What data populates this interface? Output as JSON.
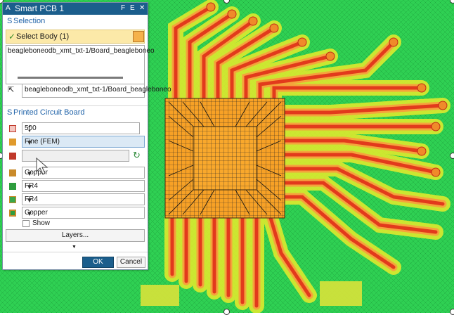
{
  "dialog": {
    "app_letter": "A",
    "title": "Smart PCB 1",
    "title_buttons": [
      "F",
      "E"
    ],
    "close_glyph": "✕"
  },
  "selection": {
    "section_marker": "S",
    "section_title": "Selection",
    "select_body_label": "Select Body (1)",
    "list_item": "beagleboneodb_xmt_txt-1/Board_beagleboneo",
    "body_field": "beagleboneodb_xmt_txt-1/Board_beagleboneo"
  },
  "pcb": {
    "section_marker": "S",
    "section_title": "Printed Circuit Board",
    "size_value": "500",
    "fidelity_value": "Fine (FEM)",
    "param_value": "",
    "layer1_value": "Copper",
    "layer2_value": "FR4",
    "layer3_value": "FR4",
    "layer4_value": "Copper",
    "show_label": "Show",
    "layers_button": "Layers...",
    "expand_glyph": "▼"
  },
  "footer": {
    "ok_label": "OK",
    "cancel_label": "Cancel"
  },
  "colors": {
    "title_bar": "#1b5e8c",
    "section_text": "#1f62a8",
    "selected_row": "#fce9a8",
    "ok_button": "#1b5e8c"
  },
  "icons": [
    "checkmark-icon",
    "cube-select-icon",
    "cursor-select-icon",
    "size-icon",
    "fidelity-icon",
    "param-icon",
    "refresh-icon",
    "layer-copper-icon",
    "layer-fr4-icon",
    "mouse-pointer-icon"
  ]
}
